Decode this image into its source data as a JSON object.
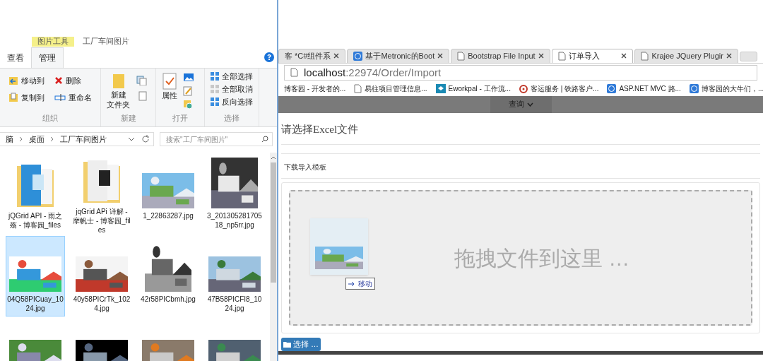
{
  "explorer": {
    "context_tab": "图片工具",
    "title": "工厂车间图片",
    "ribbon_tabs": [
      {
        "label": "查看",
        "selected": false
      },
      {
        "label": "管理",
        "selected": true
      }
    ],
    "groups": [
      {
        "label": "组织",
        "commands": [
          "移动到",
          "删除",
          "复制到",
          "重命名"
        ]
      },
      {
        "label": "新建",
        "commands": [
          "新建",
          "文件夹"
        ]
      },
      {
        "label": "打开",
        "commands": [
          "属性"
        ]
      },
      {
        "label": "选择",
        "commands": [
          "全部选择",
          "全部取消",
          "反向选择"
        ]
      }
    ],
    "breadcrumb": [
      "脑",
      "桌面",
      "工厂车间图片"
    ],
    "search": {
      "placeholder": "搜索\"工厂车间图片\""
    },
    "files": [
      {
        "kind": "folder",
        "name": "jQGrid API - 雨之殇 - 博客园_files",
        "selected": false
      },
      {
        "kind": "folder",
        "name": "jqGrid APi 详解 - 摩帆士 - 博客园_files",
        "selected": false
      },
      {
        "kind": "picture",
        "name": "1_22863287.jpg",
        "selected": false
      },
      {
        "kind": "picture",
        "name": "3_20130528170518_np5rr.jpg",
        "selected": false
      },
      {
        "kind": "picture",
        "name": "04Q58PICuay_1024.jpg",
        "selected": true
      },
      {
        "kind": "picture",
        "name": "40y58PICrTk_1024.jpg",
        "selected": false
      },
      {
        "kind": "picture",
        "name": "42r58PICbmh.jpg",
        "selected": false
      },
      {
        "kind": "picture",
        "name": "47B58PICFI8_1024.jpg",
        "selected": false
      },
      {
        "kind": "picture",
        "selected": false
      },
      {
        "kind": "picture",
        "selected": false
      },
      {
        "kind": "picture",
        "selected": false
      },
      {
        "kind": "picture",
        "selected": false
      }
    ]
  },
  "browser": {
    "tabs": [
      {
        "label": "客 *C#组件系",
        "kind": "none",
        "selected": false
      },
      {
        "label": "基于Metronic的Boot",
        "kind": "site",
        "selected": false
      },
      {
        "label": "Bootstrap File Input",
        "kind": "page",
        "selected": false
      },
      {
        "label": "订单导入",
        "kind": "page",
        "selected": true
      },
      {
        "label": "Krajee JQuery Plugir",
        "kind": "page",
        "selected": false
      }
    ],
    "address": {
      "host": "localhost",
      "path": ":22974/Order/Import"
    },
    "bookmarks": [
      {
        "label": "博客园 - 开发者的...",
        "kind": "none"
      },
      {
        "label": "易往项目管理信息...",
        "kind": "page"
      },
      {
        "label": "Eworkpal - 工作流...",
        "kind": "app"
      },
      {
        "label": "客运服务 | 铁路客户...",
        "kind": "target"
      },
      {
        "label": "ASP.NET MVC 路...",
        "kind": "site"
      },
      {
        "label": "博客园的大牛们，...",
        "kind": "site"
      }
    ],
    "nav": {
      "label": "查询"
    },
    "page": {
      "heading": "请选择Excel文件",
      "template_link": "下载导入模板",
      "drop_text": "拖拽文件到这里 …",
      "drag_tooltip": "移动",
      "browse_button": "选择 …"
    }
  }
}
